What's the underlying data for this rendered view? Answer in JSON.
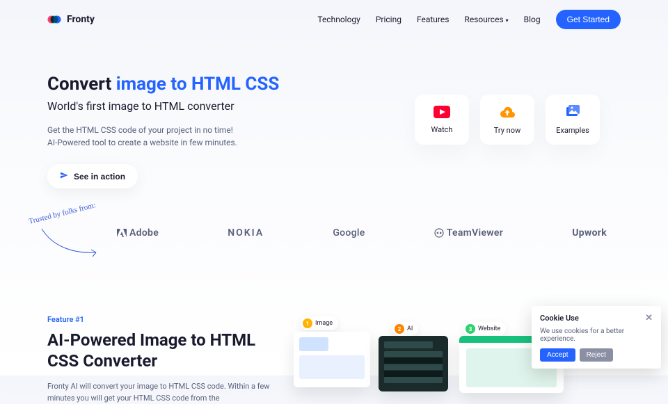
{
  "brand": {
    "name": "Fronty"
  },
  "nav": {
    "items": [
      {
        "label": "Technology"
      },
      {
        "label": "Pricing"
      },
      {
        "label": "Features"
      },
      {
        "label": "Resources"
      },
      {
        "label": "Blog"
      }
    ],
    "cta": "Get Started"
  },
  "hero": {
    "title_plain": "Convert ",
    "title_accent": "image to HTML CSS",
    "subtitle": "World's first image to HTML converter",
    "desc_line1": "Get the HTML CSS code of your project in no time!",
    "desc_line2": "AI-Powered tool to create a website in few minutes.",
    "cta": "See in action"
  },
  "cards": {
    "watch": "Watch",
    "trynow": "Try now",
    "examples": "Examples"
  },
  "trusted": {
    "label": "Trusted by folks from:",
    "logos": [
      "Adobe",
      "NOKIA",
      "Google",
      "TeamViewer",
      "Upwork"
    ]
  },
  "feature": {
    "tag": "Feature #1",
    "title": "AI-Powered Image to HTML CSS Converter",
    "desc": "Fronty AI will convert your image to HTML CSS code. Within a few minutes you will get your HTML CSS code from the",
    "pills": [
      "Image",
      "AI",
      "Website"
    ]
  },
  "cookie": {
    "title": "Cookie Use",
    "text": "We use cookies for a better experience.",
    "accept": "Accept",
    "reject": "Reject"
  }
}
